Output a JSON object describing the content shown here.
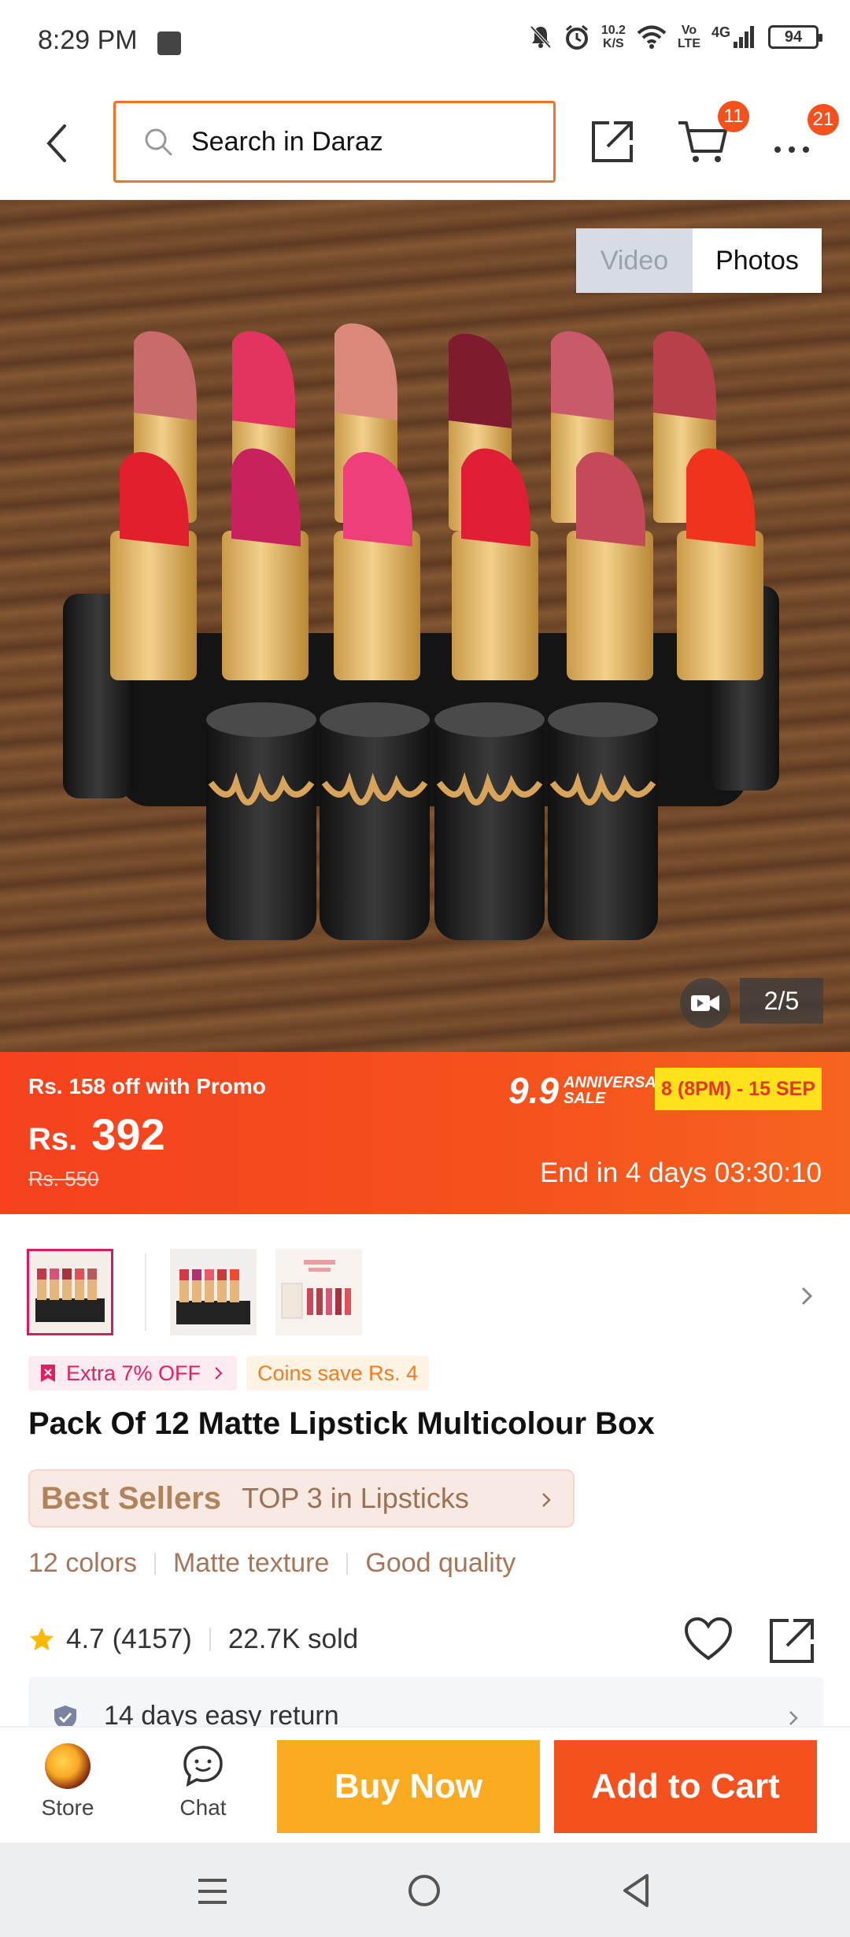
{
  "status_bar": {
    "time": "8:29 PM",
    "net_speed_value": "10.2",
    "net_speed_unit": "K/S",
    "volte_top": "Vo",
    "volte_bottom": "LTE",
    "network": "4G",
    "battery": "94"
  },
  "header": {
    "search_placeholder": "Search in Daraz",
    "cart_count": "11",
    "more_count": "21"
  },
  "media": {
    "toggle_video": "Video",
    "toggle_photos": "Photos",
    "counter": "2/5"
  },
  "promo": {
    "promo_text": "Rs. 158 off with Promo",
    "currency": "Rs.",
    "price": "392",
    "original_price": "Rs. 550",
    "sale_number": "9.9",
    "sale_line1": "ANNIVERSARY",
    "sale_line2": "SALE",
    "sale_dates": "8 (8PM) - 15 SEP",
    "countdown": "End in 4 days 03:30:10"
  },
  "tags": {
    "extra_off": "Extra 7% OFF",
    "coins": "Coins save Rs. 4"
  },
  "product": {
    "title": "Pack Of 12 Matte Lipstick Multicolour Box",
    "bestseller_label": "Best Sellers",
    "bestseller_rank": "TOP 3 in Lipsticks",
    "features": [
      "12 colors",
      "Matte texture",
      "Good quality"
    ],
    "rating": "4.7",
    "reviews": "(4157)",
    "sold": "22.7K sold",
    "return_policy": "14 days easy return"
  },
  "actions": {
    "store": "Store",
    "chat": "Chat",
    "buy_now": "Buy Now",
    "add_to_cart": "Add to Cart"
  },
  "colors": {
    "accent": "#f5511e",
    "buy_now": "#fbab1f",
    "promo_yellow": "#ffe21a"
  }
}
